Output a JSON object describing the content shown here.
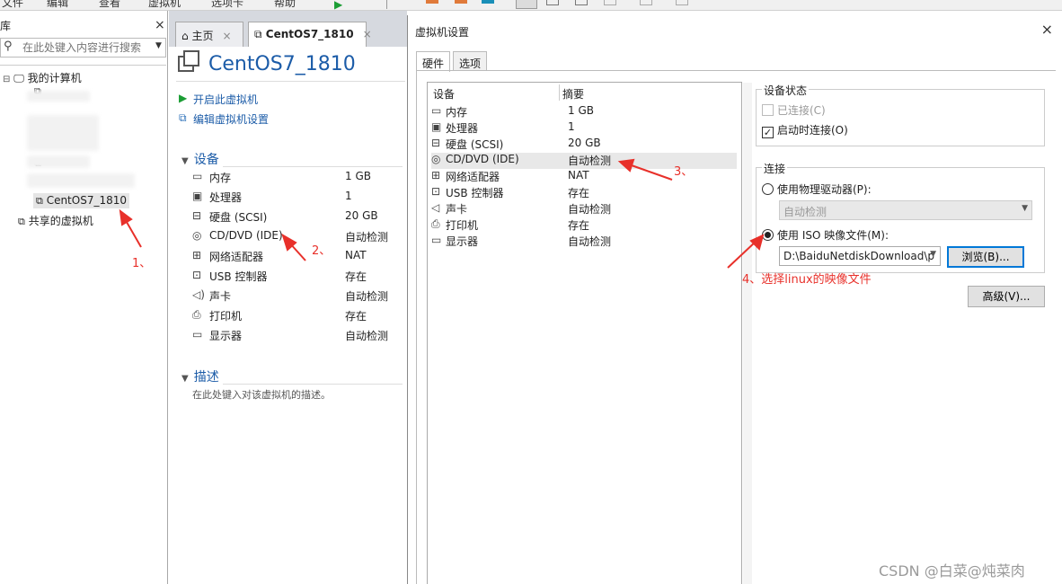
{
  "menubar": {
    "items": [
      "文件",
      "编辑",
      "查看",
      "虚拟机",
      "选项卡",
      "帮助"
    ]
  },
  "library": {
    "title": "库",
    "search_placeholder": "在此处键入内容进行搜索",
    "tree": {
      "root": "我的计算机",
      "selected_vm": "CentOS7_1810",
      "shared": "共享的虚拟机"
    }
  },
  "tabs": [
    {
      "label": "主页",
      "active": false
    },
    {
      "label": "CentOS7_1810",
      "active": true
    }
  ],
  "vm": {
    "title": "CentOS7_1810",
    "actions": [
      "开启此虚拟机",
      "编辑虚拟机设置"
    ],
    "devices_header": "设备",
    "devices": [
      {
        "icon": "memory-icon",
        "name": "内存",
        "value": "1 GB"
      },
      {
        "icon": "processor-icon",
        "name": "处理器",
        "value": "1"
      },
      {
        "icon": "hard-disk-icon",
        "name": "硬盘 (SCSI)",
        "value": "20 GB"
      },
      {
        "icon": "cd-dvd-icon",
        "name": "CD/DVD (IDE)",
        "value": "自动检测"
      },
      {
        "icon": "network-adapter-icon",
        "name": "网络适配器",
        "value": "NAT"
      },
      {
        "icon": "usb-controller-icon",
        "name": "USB 控制器",
        "value": "存在"
      },
      {
        "icon": "sound-card-icon",
        "name": "声卡",
        "value": "自动检测"
      },
      {
        "icon": "printer-icon",
        "name": "打印机",
        "value": "存在"
      },
      {
        "icon": "display-icon",
        "name": "显示器",
        "value": "自动检测"
      }
    ],
    "description_header": "描述",
    "description_placeholder": "在此处键入对该虚拟机的描述。"
  },
  "dialog": {
    "title": "虚拟机设置",
    "tabs": [
      "硬件",
      "选项"
    ],
    "list_headers": {
      "device": "设备",
      "summary": "摘要"
    },
    "devices": [
      {
        "name": "内存",
        "summary": "1 GB"
      },
      {
        "name": "处理器",
        "summary": "1"
      },
      {
        "name": "硬盘 (SCSI)",
        "summary": "20 GB"
      },
      {
        "name": "CD/DVD (IDE)",
        "summary": "自动检测"
      },
      {
        "name": "网络适配器",
        "summary": "NAT"
      },
      {
        "name": "USB 控制器",
        "summary": "存在"
      },
      {
        "name": "声卡",
        "summary": "自动检测"
      },
      {
        "name": "打印机",
        "summary": "存在"
      },
      {
        "name": "显示器",
        "summary": "自动检测"
      }
    ],
    "selected_index": 3,
    "device_status": {
      "label": "设备状态",
      "connected": "已连接(C)",
      "connect_at_power_on": "启动时连接(O)"
    },
    "connection": {
      "label": "连接",
      "use_physical": "使用物理驱动器(P):",
      "physical_value": "自动检测",
      "use_iso": "使用 ISO 映像文件(M):",
      "iso_path": "D:\\BaiduNetdiskDownload\\p",
      "browse": "浏览(B)..."
    },
    "advanced": "高级(V)..."
  },
  "annotations": {
    "a1": "1、",
    "a2": "2、",
    "a3": "3、",
    "a4": "4、选择linux的映像文件",
    "color": "#e8302a"
  },
  "watermark": "CSDN @白菜@炖菜肉"
}
